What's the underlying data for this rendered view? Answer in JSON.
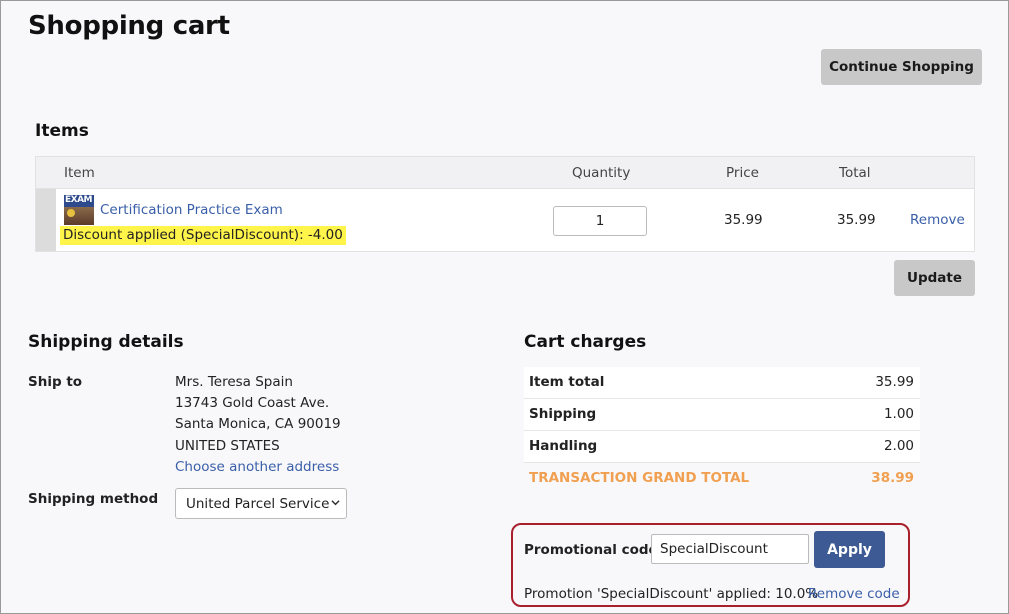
{
  "page": {
    "title": "Shopping cart",
    "continue_label": "Continue Shopping"
  },
  "items": {
    "heading": "Items",
    "columns": {
      "item": "Item",
      "quantity": "Quantity",
      "price": "Price",
      "total": "Total"
    },
    "rows": [
      {
        "thumb_text": "EXAM",
        "name": "Certification Practice Exam",
        "discount": "Discount applied (SpecialDiscount): -4.00",
        "quantity": "1",
        "price": "35.99",
        "total": "35.99",
        "remove_label": "Remove"
      }
    ],
    "update_label": "Update"
  },
  "shipping": {
    "heading": "Shipping details",
    "ship_to_label": "Ship to",
    "address": [
      "Mrs. Teresa Spain",
      "13743 Gold Coast Ave.",
      "Santa Monica, CA 90019",
      "UNITED STATES"
    ],
    "choose_address_label": "Choose another address",
    "method_label": "Shipping method",
    "method_value": "United Parcel Service"
  },
  "charges": {
    "heading": "Cart charges",
    "rows": [
      {
        "label": "Item total",
        "value": "35.99"
      },
      {
        "label": "Shipping",
        "value": "1.00"
      },
      {
        "label": "Handling",
        "value": "2.00"
      }
    ],
    "grand_total": {
      "label": "TRANSACTION GRAND TOTAL",
      "value": "38.99"
    }
  },
  "promo": {
    "label": "Promotional code",
    "value": "SpecialDiscount",
    "apply_label": "Apply",
    "applied_text": "Promotion 'SpecialDiscount' applied: 10.0%",
    "remove_code_label": "Remove code"
  },
  "colors": {
    "link": "#3a5fa8",
    "highlight": "#fff44a",
    "grand_total": "#f0a050",
    "promo_border": "#a8202c",
    "apply_button": "#3e5a95"
  }
}
